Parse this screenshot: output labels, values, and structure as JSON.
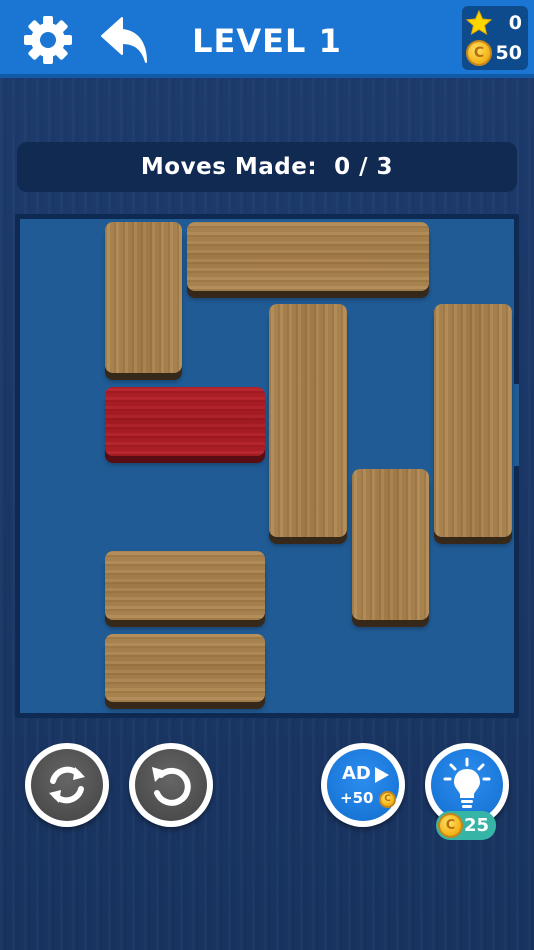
{
  "header": {
    "level_title": "LEVEL 1",
    "settings_icon": "gear-icon",
    "back_icon": "undo-arrow-icon",
    "stars": "0",
    "coins": "50"
  },
  "moves": {
    "label": "Moves Made:",
    "made": "0",
    "separator": "/",
    "target": "3"
  },
  "board": {
    "grid_size": 6,
    "target_color": "#b52129",
    "wood_color": "#a87f4a",
    "board_color": "#205b95"
  },
  "controls": {
    "restart_icon": "refresh-icon",
    "undo_icon": "undo-icon",
    "ad_label": "AD",
    "ad_reward": "+50",
    "ad_icon": "play-icon",
    "hint_icon": "lightbulb-icon",
    "hint_cost": "25"
  },
  "colors": {
    "topbar": "#1a76d2",
    "background": "#1c3a6c",
    "button_gray": "#4d4d4d",
    "button_blue": "#1977d8",
    "badge_teal": "#36b5a6",
    "star": "#ffd700"
  }
}
